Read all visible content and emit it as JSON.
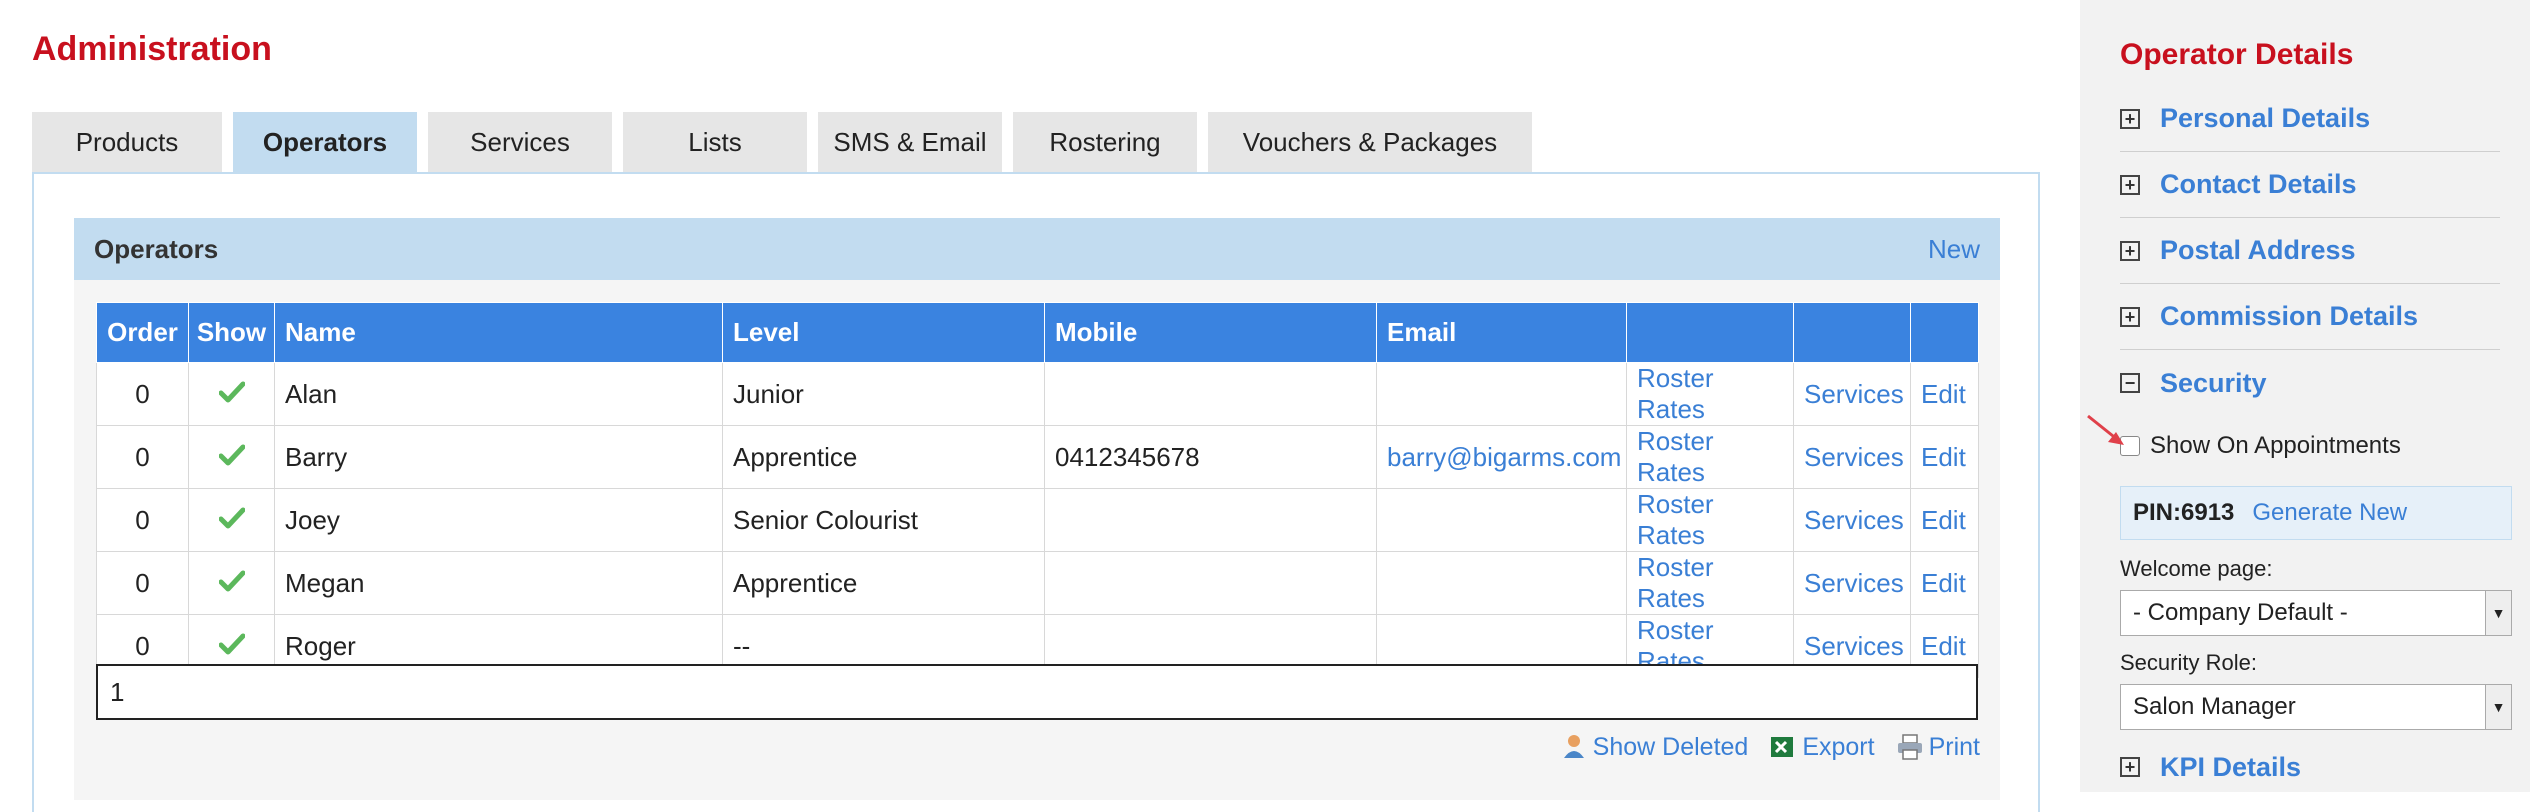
{
  "page": {
    "title": "Administration"
  },
  "tabs": [
    {
      "label": "Products",
      "active": false
    },
    {
      "label": "Operators",
      "active": true
    },
    {
      "label": "Services",
      "active": false
    },
    {
      "label": "Lists",
      "active": false
    },
    {
      "label": "SMS & Email",
      "active": false
    },
    {
      "label": "Rostering",
      "active": false
    },
    {
      "label": "Vouchers & Packages",
      "active": false
    }
  ],
  "operators_section": {
    "title": "Operators",
    "new_label": "New"
  },
  "table": {
    "headers": [
      "Order",
      "Show",
      "Name",
      "Level",
      "Mobile",
      "Email",
      "",
      "",
      ""
    ],
    "rows": [
      {
        "order": "0",
        "show": "check-icon",
        "name": "Alan",
        "level": "Junior",
        "mobile": "",
        "email": "",
        "roster": "Roster Rates",
        "services": "Services",
        "edit": "Edit"
      },
      {
        "order": "0",
        "show": "check-icon",
        "name": "Barry",
        "level": "Apprentice",
        "mobile": "0412345678",
        "email": "barry@bigarms.com",
        "roster": "Roster Rates",
        "services": "Services",
        "edit": "Edit"
      },
      {
        "order": "0",
        "show": "check-icon",
        "name": "Joey",
        "level": "Senior Colourist",
        "mobile": "",
        "email": "",
        "roster": "Roster Rates",
        "services": "Services",
        "edit": "Edit"
      },
      {
        "order": "0",
        "show": "check-icon",
        "name": "Megan",
        "level": "Apprentice",
        "mobile": "",
        "email": "",
        "roster": "Roster Rates",
        "services": "Services",
        "edit": "Edit"
      },
      {
        "order": "0",
        "show": "check-icon",
        "name": "Roger",
        "level": "--",
        "mobile": "",
        "email": "",
        "roster": "Roster Rates",
        "services": "Services",
        "edit": "Edit"
      }
    ],
    "page": "1"
  },
  "footer": {
    "show_deleted": "Show Deleted",
    "export": "Export",
    "print": "Print"
  },
  "sidebar": {
    "title": "Operator Details",
    "sections": [
      {
        "label": "Personal Details",
        "expanded": false
      },
      {
        "label": "Contact Details",
        "expanded": false
      },
      {
        "label": "Postal Address",
        "expanded": false
      },
      {
        "label": "Commission Details",
        "expanded": false
      },
      {
        "label": "Security",
        "expanded": true
      }
    ],
    "show_on_appointments": "Show On Appointments",
    "pin": "PIN:6913",
    "generate_new": "Generate New",
    "welcome_page_label": "Welcome page:",
    "welcome_page_value": "- Company Default -",
    "security_role_label": "Security Role:",
    "security_role_value": "Salon Manager",
    "kpi_label": "KPI Details"
  },
  "colors": {
    "brand_red": "#c8101e",
    "link_blue": "#3a7fd5",
    "header_blue": "#3a83e0",
    "light_blue": "#c2dcf0",
    "check_green": "#5cb85c"
  }
}
